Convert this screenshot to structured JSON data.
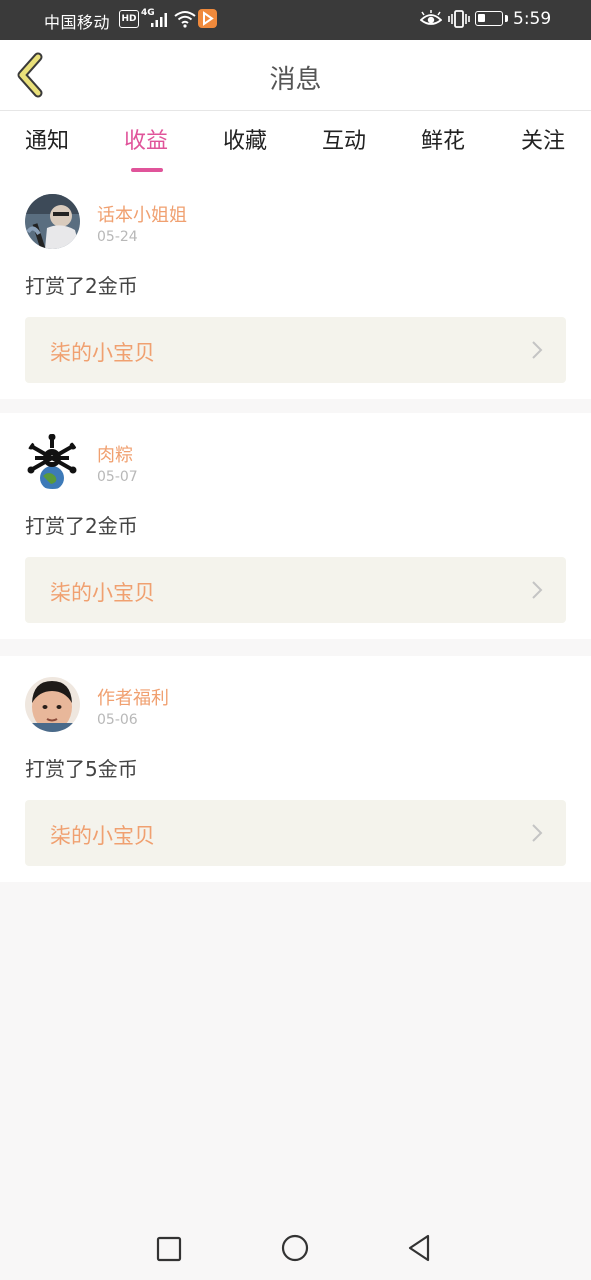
{
  "status_bar": {
    "carrier": "中国移动",
    "hd_badge": "HD",
    "network_type": "4G",
    "battery_percent": 35,
    "time": "5:59"
  },
  "header": {
    "title": "消息",
    "back_icon": "chevron-left-icon"
  },
  "tabs": [
    {
      "label": "通知",
      "active": false
    },
    {
      "label": "收益",
      "active": true
    },
    {
      "label": "收藏",
      "active": false
    },
    {
      "label": "互动",
      "active": false
    },
    {
      "label": "鲜花",
      "active": false
    },
    {
      "label": "关注",
      "active": false
    }
  ],
  "messages": [
    {
      "user": "话本小姐姐",
      "date": "05-24",
      "action": "打赏了2金币",
      "target": "柒的小宝贝"
    },
    {
      "user": "肉粽",
      "date": "05-07",
      "action": "打赏了2金币",
      "target": "柒的小宝贝"
    },
    {
      "user": "作者福利",
      "date": "05-06",
      "action": "打赏了5金币",
      "target": "柒的小宝贝"
    }
  ],
  "colors": {
    "accent": "#e0549a",
    "name_orange": "#f0a070",
    "back_icon_yellow": "#e9e07a",
    "link_bg": "#f4f3ec"
  },
  "nav_bar": {
    "icons": [
      "recent-apps-icon",
      "home-icon",
      "back-icon"
    ]
  }
}
